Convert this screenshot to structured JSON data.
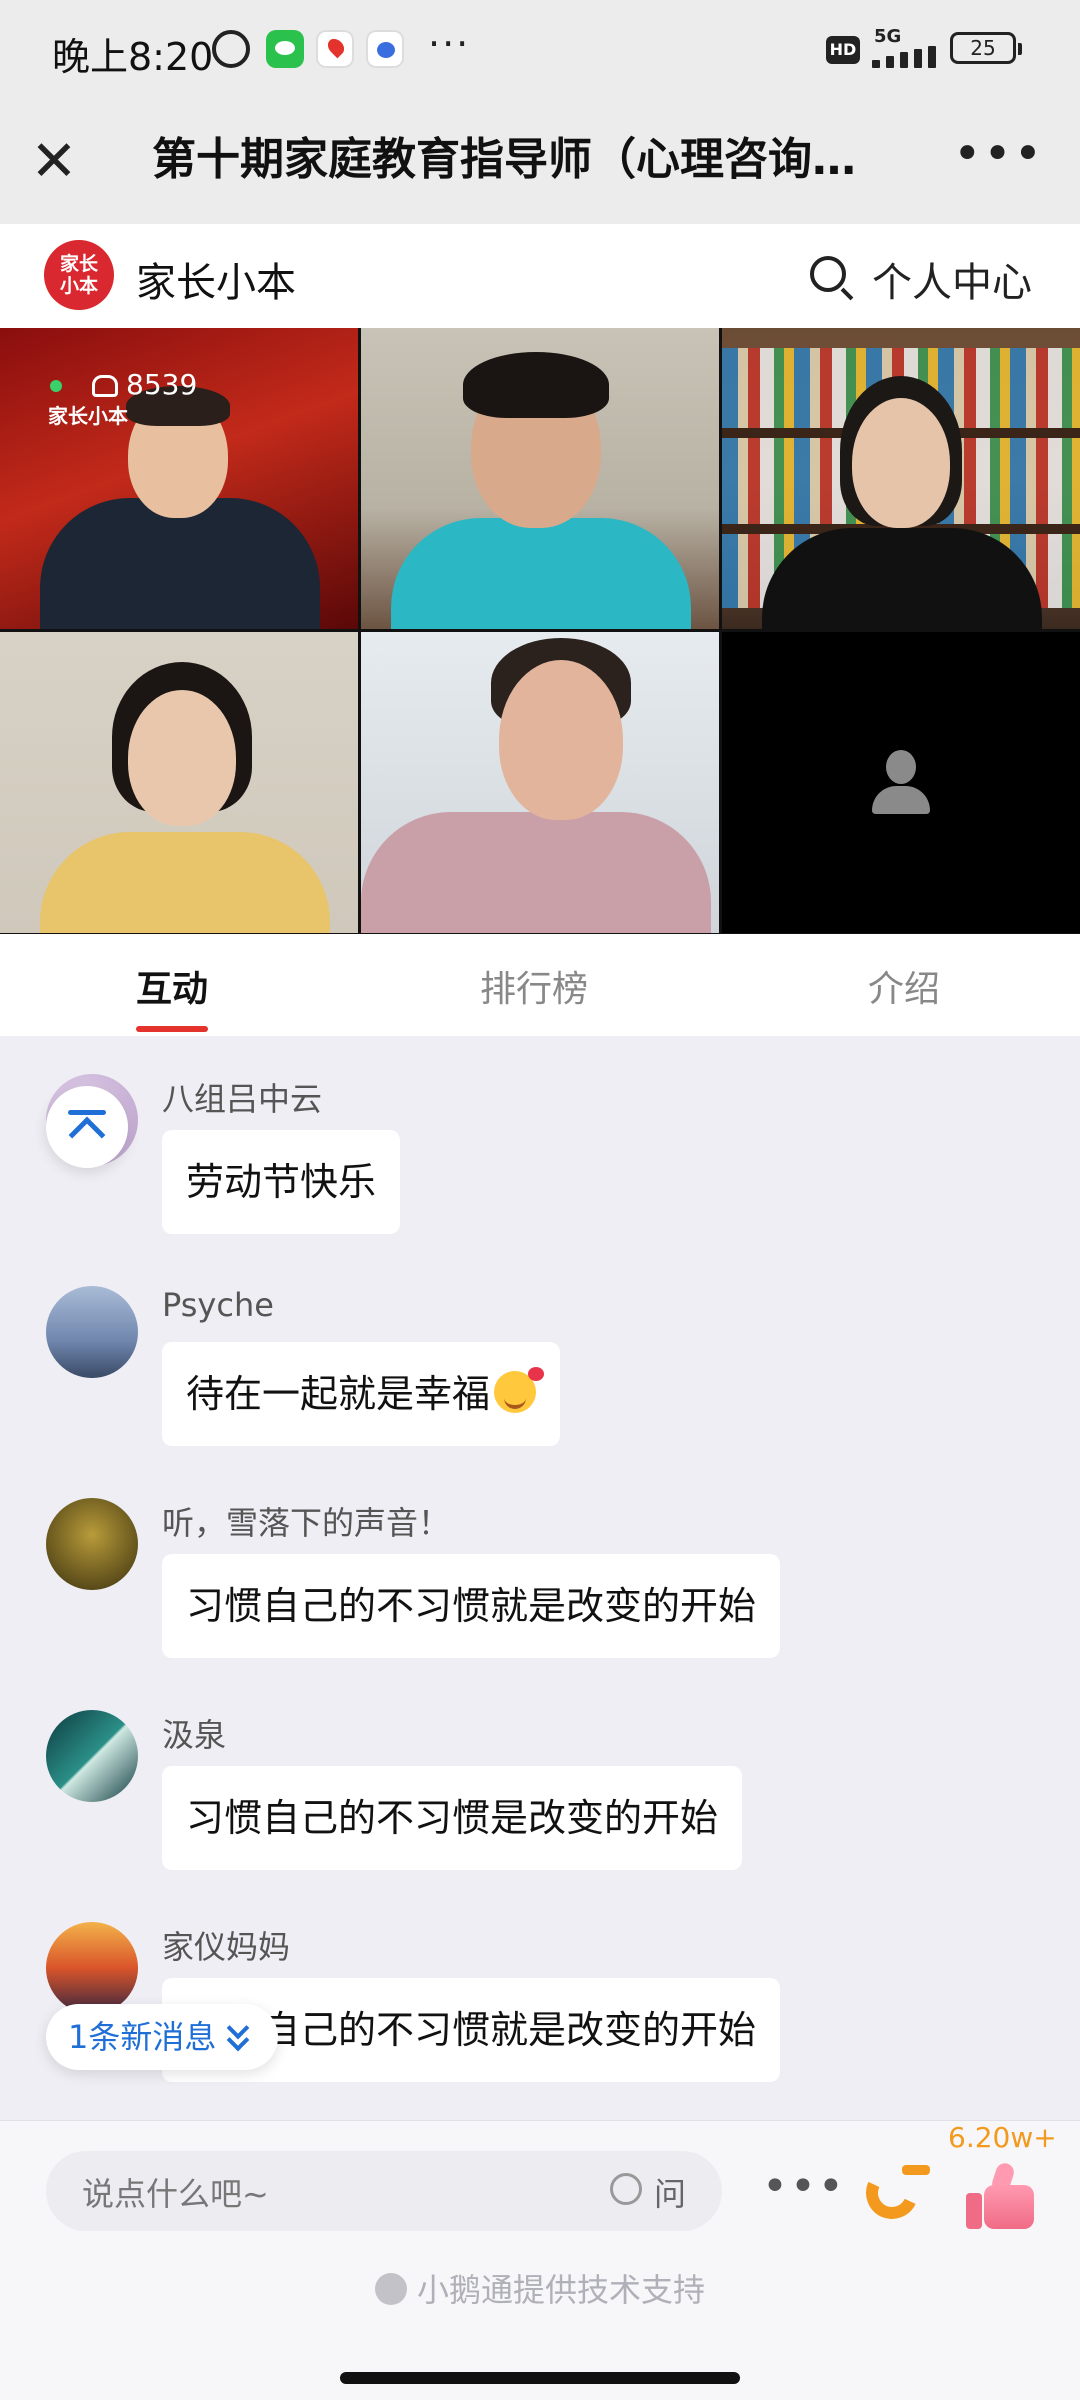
{
  "status_bar": {
    "time": "晚上8:20",
    "more": "···",
    "hd": "HD",
    "network": "5G",
    "battery": "25"
  },
  "title_bar": {
    "close_glyph": "✕",
    "title": "第十期家庭教育指导师（心理咨询…",
    "menu_glyph": "•••"
  },
  "brand": {
    "logo_text": "家长小本",
    "name": "家长小本",
    "user_center": "个人中心"
  },
  "live": {
    "viewer_count": "8539",
    "watermark": "家长小本"
  },
  "tabs": [
    {
      "label": "互动",
      "active": true
    },
    {
      "label": "排行榜",
      "active": false
    },
    {
      "label": "介绍",
      "active": false
    }
  ],
  "messages": [
    {
      "user": "八组吕中云",
      "text": "劳动节快乐",
      "avatar": "#c9b6d9"
    },
    {
      "user": "Psyche",
      "text": "待在一起就是幸福",
      "emoji": "smiling-face-with-hearts-icon",
      "avatar": "#7f93b4"
    },
    {
      "user": "听，雪落下的声音！",
      "text": "习惯自己的不习惯就是改变的开始",
      "avatar": "#5a4a18"
    },
    {
      "user": "汲泉",
      "text": "习惯自己的不习惯是改变的开始",
      "avatar": "#1f6f6a"
    },
    {
      "user": "家仪妈妈",
      "text": "习惯自己的不习惯就是改变的开始",
      "avatar": "#d9642a"
    }
  ],
  "new_message_pill": "1条新消息",
  "input": {
    "placeholder": "说点什么吧~",
    "question_label": "问",
    "more": "•••"
  },
  "likes": "6.20w+",
  "powered_by": "小鹅通提供技术支持",
  "colors": {
    "accent_red": "#e4332d",
    "link_blue": "#1f6fd6",
    "orange": "#f39a1e"
  }
}
